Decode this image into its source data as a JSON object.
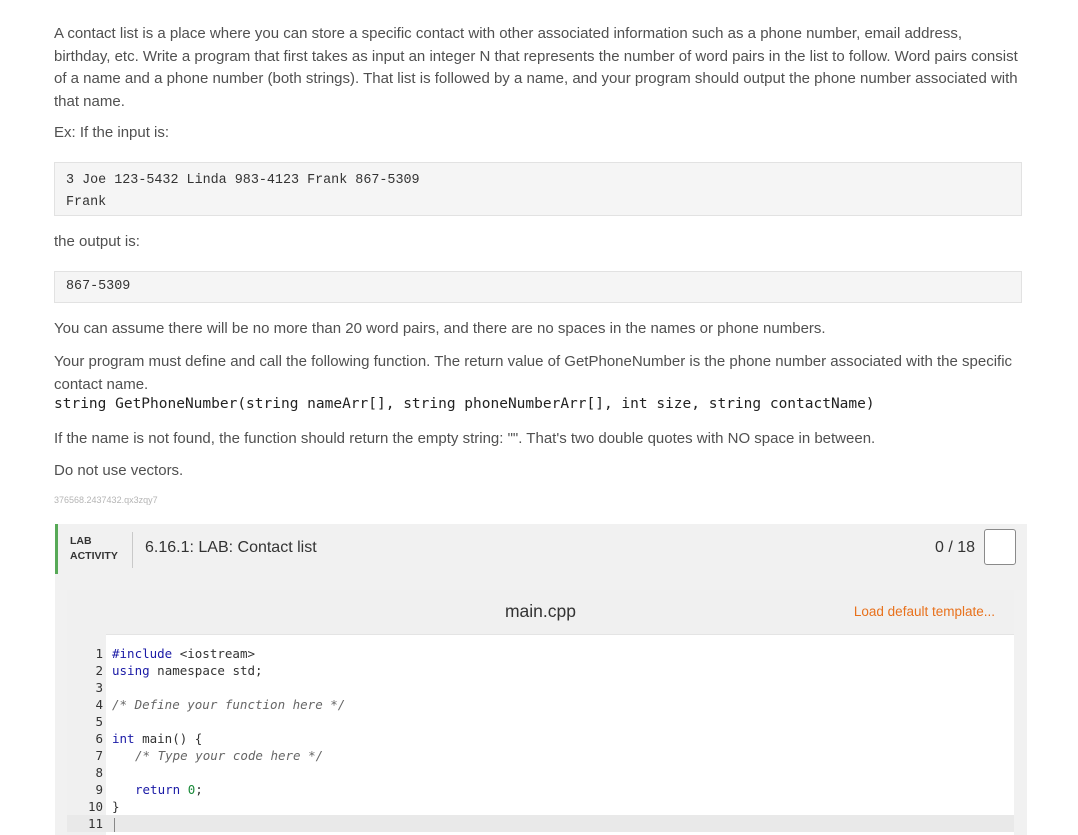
{
  "description": {
    "p1": "A contact list is a place where you can store a specific contact with other associated information such as a phone number, email address, birthday, etc. Write a program that first takes as input an integer N that represents the number of word pairs in the list to follow. Word pairs consist of a name and a phone number (both strings). That list is followed by a name, and your program should output the phone number associated with that name.",
    "ex_label": "Ex: If the input is:",
    "input_example": [
      "3 Joe 123-5432 Linda 983-4123 Frank 867-5309",
      "Frank"
    ],
    "output_label": "the output is:",
    "output_example": [
      "867-5309"
    ],
    "assume": "You can assume there will be no more than 20 word pairs, and there are no spaces in the names or phone numbers.",
    "must_define": "Your program must define and call the following function. The return value of GetPhoneNumber is the phone number associated with the specific contact name.",
    "signature": "string GetPhoneNumber(string nameArr[], string phoneNumberArr[], int size, string contactName)",
    "not_found": "If the name is not found, the function should return the empty string: \"\". That's two double quotes with NO space in between.",
    "no_vectors": "Do not use vectors.",
    "id_code": "376568.2437432.qx3zqy7"
  },
  "lab": {
    "tag_line1": "LAB",
    "tag_line2": "ACTIVITY",
    "title": "6.16.1: LAB: Contact list",
    "score": "0 / 18"
  },
  "editor": {
    "filename": "main.cpp",
    "load_template": "Load default template...",
    "line_numbers": [
      "1",
      "2",
      "3",
      "4",
      "5",
      "6",
      "7",
      "8",
      "9",
      "10",
      "11"
    ],
    "code": {
      "l1_a": "#include ",
      "l1_b": "<iostream>",
      "l2_a": "using",
      "l2_b": " namespace ",
      "l2_c": "std;",
      "l4": "/* Define your function here */",
      "l6_a": "int",
      "l6_b": " main() {",
      "l7": "/* Type your code here */",
      "l9_a": "return ",
      "l9_b": "0",
      "l9_c": ";",
      "l10": "}"
    }
  }
}
